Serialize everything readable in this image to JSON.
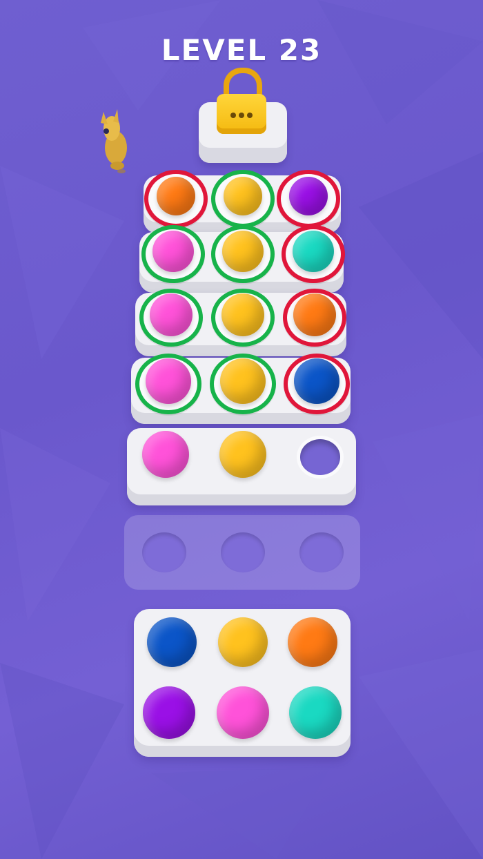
{
  "level_label": "LEVEL 23",
  "colors": {
    "orange": "#ff7a14",
    "yellow": "#ffc21e",
    "purple": "#9a10e6",
    "pink": "#ff52d9",
    "teal": "#1ad9c2",
    "blue": "#0b55c8",
    "ring_red": "#e0163a",
    "ring_green": "#17b34a"
  },
  "locked_item": {
    "icon": "padlock-icon",
    "label": "•••"
  },
  "collectible": {
    "icon": "golden-llama-icon"
  },
  "rows": [
    {
      "balls": [
        {
          "color": "orange",
          "ring": "red"
        },
        {
          "color": "yellow",
          "ring": "green"
        },
        {
          "color": "purple",
          "ring": "red"
        }
      ]
    },
    {
      "balls": [
        {
          "color": "pink",
          "ring": "green"
        },
        {
          "color": "yellow",
          "ring": "green"
        },
        {
          "color": "teal",
          "ring": "red"
        }
      ]
    },
    {
      "balls": [
        {
          "color": "pink",
          "ring": "green"
        },
        {
          "color": "yellow",
          "ring": "green"
        },
        {
          "color": "orange",
          "ring": "red"
        }
      ]
    },
    {
      "balls": [
        {
          "color": "pink",
          "ring": "green"
        },
        {
          "color": "yellow",
          "ring": "green"
        },
        {
          "color": "blue",
          "ring": "red"
        }
      ]
    },
    {
      "balls": [
        {
          "color": "pink",
          "ring": null
        },
        {
          "color": "yellow",
          "ring": null
        },
        {
          "color": null,
          "ring": null
        }
      ]
    },
    {
      "balls": [
        {
          "color": null,
          "ring": null
        },
        {
          "color": null,
          "ring": null
        },
        {
          "color": null,
          "ring": null
        }
      ],
      "ghost": true
    }
  ],
  "palette": [
    [
      "blue",
      "yellow",
      "orange"
    ],
    [
      "purple",
      "pink",
      "teal"
    ]
  ]
}
